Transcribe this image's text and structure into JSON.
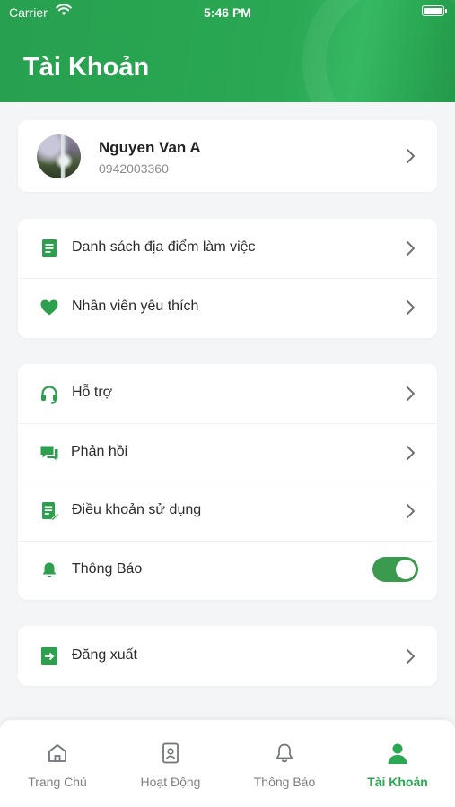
{
  "statusbar": {
    "carrier": "Carrier",
    "time": "5:46 PM"
  },
  "header": {
    "title": "Tài Khoản"
  },
  "profile": {
    "name": "Nguyen Van A",
    "phone": "0942003360"
  },
  "group1": [
    {
      "label": "Danh sách địa điểm làm việc",
      "icon": "list-document-icon"
    },
    {
      "label": "Nhân viên yêu thích",
      "icon": "heart-icon"
    }
  ],
  "group2": [
    {
      "label": "Hỗ trợ",
      "icon": "headset-icon"
    },
    {
      "label": "Phản hồi",
      "icon": "chat-icon"
    },
    {
      "label": "Điều khoản sử dụng",
      "icon": "terms-document-icon"
    },
    {
      "label": "Thông Báo",
      "icon": "bell-icon",
      "toggle_on": true
    }
  ],
  "logout": {
    "label": "Đăng xuất",
    "icon": "logout-icon"
  },
  "tabs": [
    {
      "label": "Trang Chủ",
      "icon": "home-icon",
      "active": false
    },
    {
      "label": "Hoạt Động",
      "icon": "activity-icon",
      "active": false
    },
    {
      "label": "Thông Báo",
      "icon": "bell-outline-icon",
      "active": false
    },
    {
      "label": "Tài Khoản",
      "icon": "user-icon",
      "active": true
    }
  ],
  "colors": {
    "brand_green": "#2aa853",
    "toggle_green": "#3a9a4e",
    "icon_green": "#2e9e4f"
  }
}
